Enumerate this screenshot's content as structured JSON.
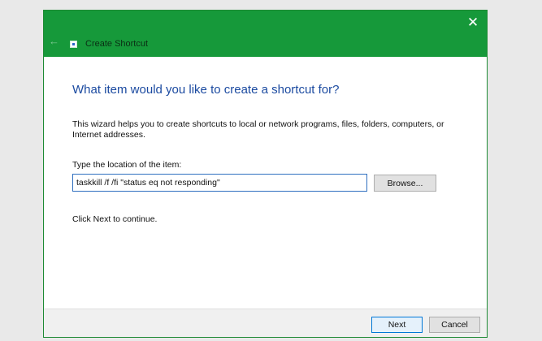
{
  "window": {
    "title": "Create Shortcut",
    "back_icon": "back-arrow-icon",
    "close_icon": "close-icon",
    "app_icon": "shortcut-app-icon",
    "accent_color": "#16993a"
  },
  "main": {
    "heading": "What item would you like to create a shortcut for?",
    "description": "This wizard helps you to create shortcuts to local or network programs, files, folders, computers, or Internet addresses.",
    "location_label": "Type the location of the item:",
    "location_value": "taskkill /f /fi \"status eq not responding\"",
    "browse_label": "Browse...",
    "hint": "Click Next to continue."
  },
  "footer": {
    "next_label": "Next",
    "cancel_label": "Cancel"
  }
}
